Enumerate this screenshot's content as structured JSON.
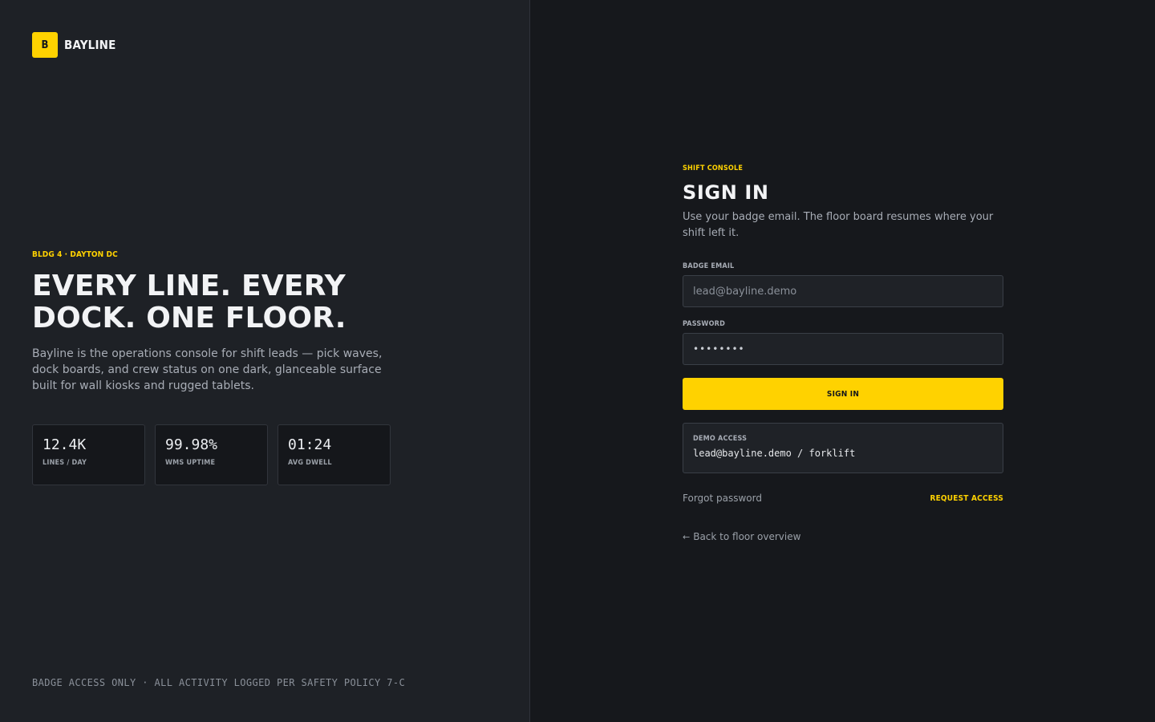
{
  "brand": {
    "mark": "B",
    "name": "BAYLINE",
    "accent_color": "#ffd200"
  },
  "hero": {
    "eyebrow": "BLDG 4 · DAYTON DC",
    "headline_line1": "EVERY LINE. EVERY",
    "headline_line2": "DOCK. ONE FLOOR.",
    "lede": "Bayline is the operations console for shift leads — pick waves, dock boards, and crew status on one dark, glanceable surface built for wall kiosks and rugged tablets."
  },
  "stats": [
    {
      "value": "12.4K",
      "label": "LINES / DAY"
    },
    {
      "value": "99.98%",
      "label": "WMS UPTIME"
    },
    {
      "value": "01:24",
      "label": "AVG DWELL"
    }
  ],
  "footnote": "BADGE ACCESS ONLY · ALL ACTIVITY LOGGED PER SAFETY POLICY 7-C",
  "form": {
    "kicker": "SHIFT CONSOLE",
    "title": "SIGN IN",
    "subtitle": "Use your badge email. The floor board resumes where your shift left it.",
    "email_label": "BADGE EMAIL",
    "email_placeholder": "lead@bayline.demo",
    "email_value": "",
    "password_label": "PASSWORD",
    "password_value": "••••••••",
    "submit_label": "SIGN IN",
    "demo_label": "DEMO ACCESS",
    "demo_value": "lead@bayline.demo / forklift",
    "forgot_label": "Forgot password",
    "request_label": "REQUEST ACCESS",
    "back_icon": "arrow-left-icon",
    "back_label": "Back to floor overview"
  }
}
